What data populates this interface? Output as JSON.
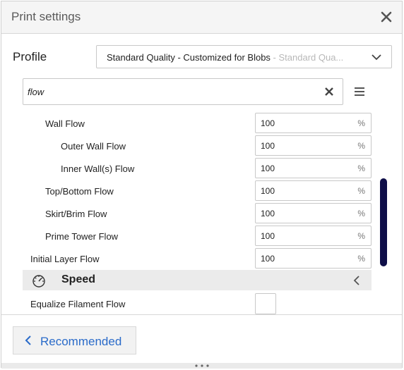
{
  "window": {
    "title": "Print settings"
  },
  "profile": {
    "label": "Profile",
    "selected": "Standard Quality - Customized for Blobs",
    "selected_sub": " - Standard Qua..."
  },
  "search": {
    "value": "flow"
  },
  "settings": [
    {
      "label": "Wall Flow",
      "value": "100",
      "unit": "%"
    },
    {
      "label": "Outer Wall Flow",
      "value": "100",
      "unit": "%"
    },
    {
      "label": "Inner Wall(s) Flow",
      "value": "100",
      "unit": "%"
    },
    {
      "label": "Top/Bottom Flow",
      "value": "100",
      "unit": "%"
    },
    {
      "label": "Skirt/Brim Flow",
      "value": "100",
      "unit": "%"
    },
    {
      "label": "Prime Tower Flow",
      "value": "100",
      "unit": "%"
    },
    {
      "label": "Initial Layer Flow",
      "value": "100",
      "unit": "%"
    }
  ],
  "category": {
    "label": "Speed"
  },
  "equalize": {
    "label": "Equalize Filament Flow",
    "checked": false
  },
  "footer": {
    "recommended_label": "Recommended"
  },
  "icons": {
    "close": "close-icon",
    "dropdown": "chevron-down-icon",
    "clear": "clear-icon",
    "menu": "hamburger-menu-icon",
    "speed": "gauge-icon",
    "collapse": "chevron-left-icon",
    "back": "chevron-left-icon",
    "handle": "drag-handle-icon"
  },
  "colors": {
    "accent": "#2a6bc9",
    "scrollbar": "#0f0e48"
  }
}
